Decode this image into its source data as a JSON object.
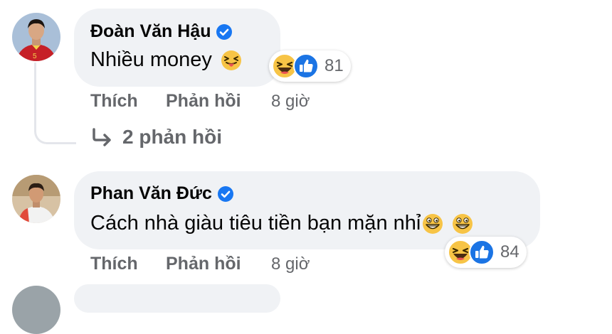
{
  "colors": {
    "bubble_bg": "#f0f2f5",
    "meta_gray": "#65676b",
    "verified_blue": "#1877f2",
    "like_blue": "#1b74e4",
    "haha_yellow": "#f7c446"
  },
  "comments": [
    {
      "author": "Đoàn Văn Hậu",
      "verified": true,
      "avatar_icon": "footballer-avatar",
      "text": "Nhiều money",
      "inline_emojis": [
        "squinting-tongue-emoji"
      ],
      "reactions": {
        "icons": [
          "haha-icon",
          "like-icon"
        ],
        "count": "81"
      },
      "actions": {
        "like": "Thích",
        "reply": "Phản hồi",
        "time": "8 giờ"
      },
      "replies_label": "2 phản hồi"
    },
    {
      "author": "Phan Văn Đức",
      "verified": true,
      "avatar_icon": "person-avatar",
      "text": "Cách nhà giàu tiêu tiền bạn mặn nhỉ",
      "inline_emojis": [
        "grinning-squint-emoji",
        "grinning-squint-emoji"
      ],
      "reactions": {
        "icons": [
          "haha-icon",
          "like-icon"
        ],
        "count": "84"
      },
      "actions": {
        "like": "Thích",
        "reply": "Phản hồi",
        "time": "8 giờ"
      }
    }
  ]
}
